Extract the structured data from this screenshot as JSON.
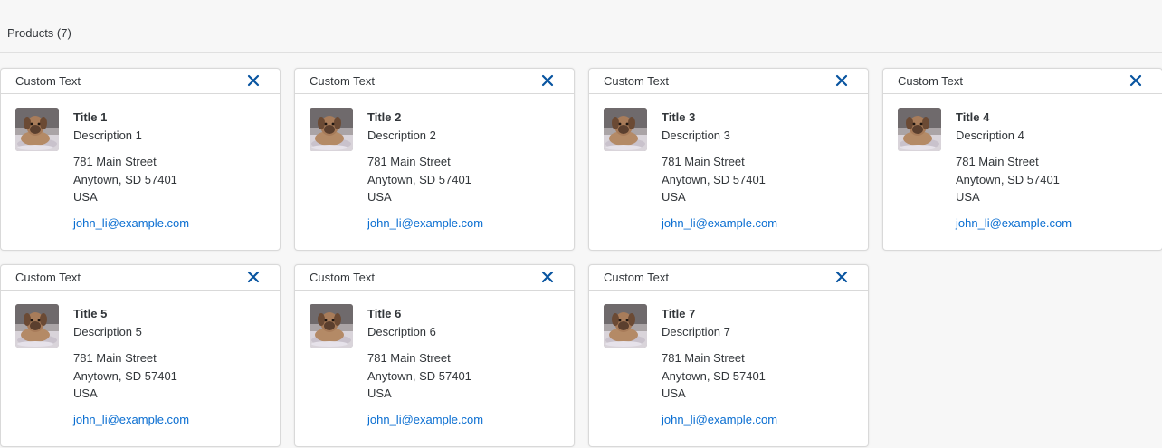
{
  "toolbar": {
    "title": "Products (7)"
  },
  "colors": {
    "accent": "#0a6ed1",
    "close": "#0854a0"
  },
  "cards": [
    {
      "header": "Custom Text",
      "title": "Title 1",
      "description": "Description 1",
      "street": "781 Main Street",
      "city": "Anytown, SD 57401",
      "country": "USA",
      "email": "john_li@example.com",
      "close_icon": "close-icon"
    },
    {
      "header": "Custom Text",
      "title": "Title 2",
      "description": "Description 2",
      "street": "781 Main Street",
      "city": "Anytown, SD 57401",
      "country": "USA",
      "email": "john_li@example.com",
      "close_icon": "close-icon"
    },
    {
      "header": "Custom Text",
      "title": "Title 3",
      "description": "Description 3",
      "street": "781 Main Street",
      "city": "Anytown, SD 57401",
      "country": "USA",
      "email": "john_li@example.com",
      "close_icon": "close-icon"
    },
    {
      "header": "Custom Text",
      "title": "Title 4",
      "description": "Description 4",
      "street": "781 Main Street",
      "city": "Anytown, SD 57401",
      "country": "USA",
      "email": "john_li@example.com",
      "close_icon": "close-icon"
    },
    {
      "header": "Custom Text",
      "title": "Title 5",
      "description": "Description 5",
      "street": "781 Main Street",
      "city": "Anytown, SD 57401",
      "country": "USA",
      "email": "john_li@example.com",
      "close_icon": "close-icon"
    },
    {
      "header": "Custom Text",
      "title": "Title 6",
      "description": "Description 6",
      "street": "781 Main Street",
      "city": "Anytown, SD 57401",
      "country": "USA",
      "email": "john_li@example.com",
      "close_icon": "close-icon"
    },
    {
      "header": "Custom Text",
      "title": "Title 7",
      "description": "Description 7",
      "street": "781 Main Street",
      "city": "Anytown, SD 57401",
      "country": "USA",
      "email": "john_li@example.com",
      "close_icon": "close-icon"
    }
  ]
}
